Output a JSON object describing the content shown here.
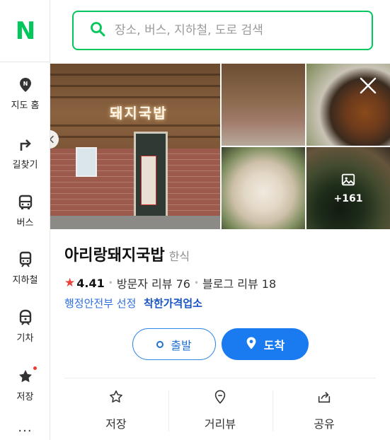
{
  "app": {
    "logo": "N"
  },
  "rail": {
    "items": [
      {
        "label": "지도 홈",
        "icon": "map-home-pin-icon"
      },
      {
        "label": "길찾기",
        "icon": "directions-arrow-icon"
      },
      {
        "label": "버스",
        "icon": "bus-icon"
      },
      {
        "label": "지하철",
        "icon": "subway-icon"
      },
      {
        "label": "기차",
        "icon": "train-icon"
      },
      {
        "label": "저장",
        "icon": "star-saved-icon"
      }
    ],
    "more": "···"
  },
  "search": {
    "placeholder": "장소, 버스, 지하철, 도로 검색",
    "value": ""
  },
  "photos": {
    "main_sign": "돼지국밥",
    "more_count": "+161"
  },
  "place": {
    "name": "아리랑돼지국밥",
    "category": "한식",
    "rating": "4.41",
    "visitor_reviews": "방문자 리뷰 76",
    "blog_reviews": "블로그 리뷰 18",
    "cert_gov": "행정안전부 선정",
    "cert_label": "착한가격업소"
  },
  "buttons": {
    "depart": "출발",
    "arrive": "도착"
  },
  "actions": [
    {
      "label": "저장",
      "icon": "star-outline-icon"
    },
    {
      "label": "거리뷰",
      "icon": "street-view-pin-icon"
    },
    {
      "label": "공유",
      "icon": "share-icon"
    }
  ],
  "colors": {
    "brand": "#03c75a",
    "primary": "#1a7bf0",
    "star": "#e8423a",
    "cert": "#1a54c5"
  }
}
